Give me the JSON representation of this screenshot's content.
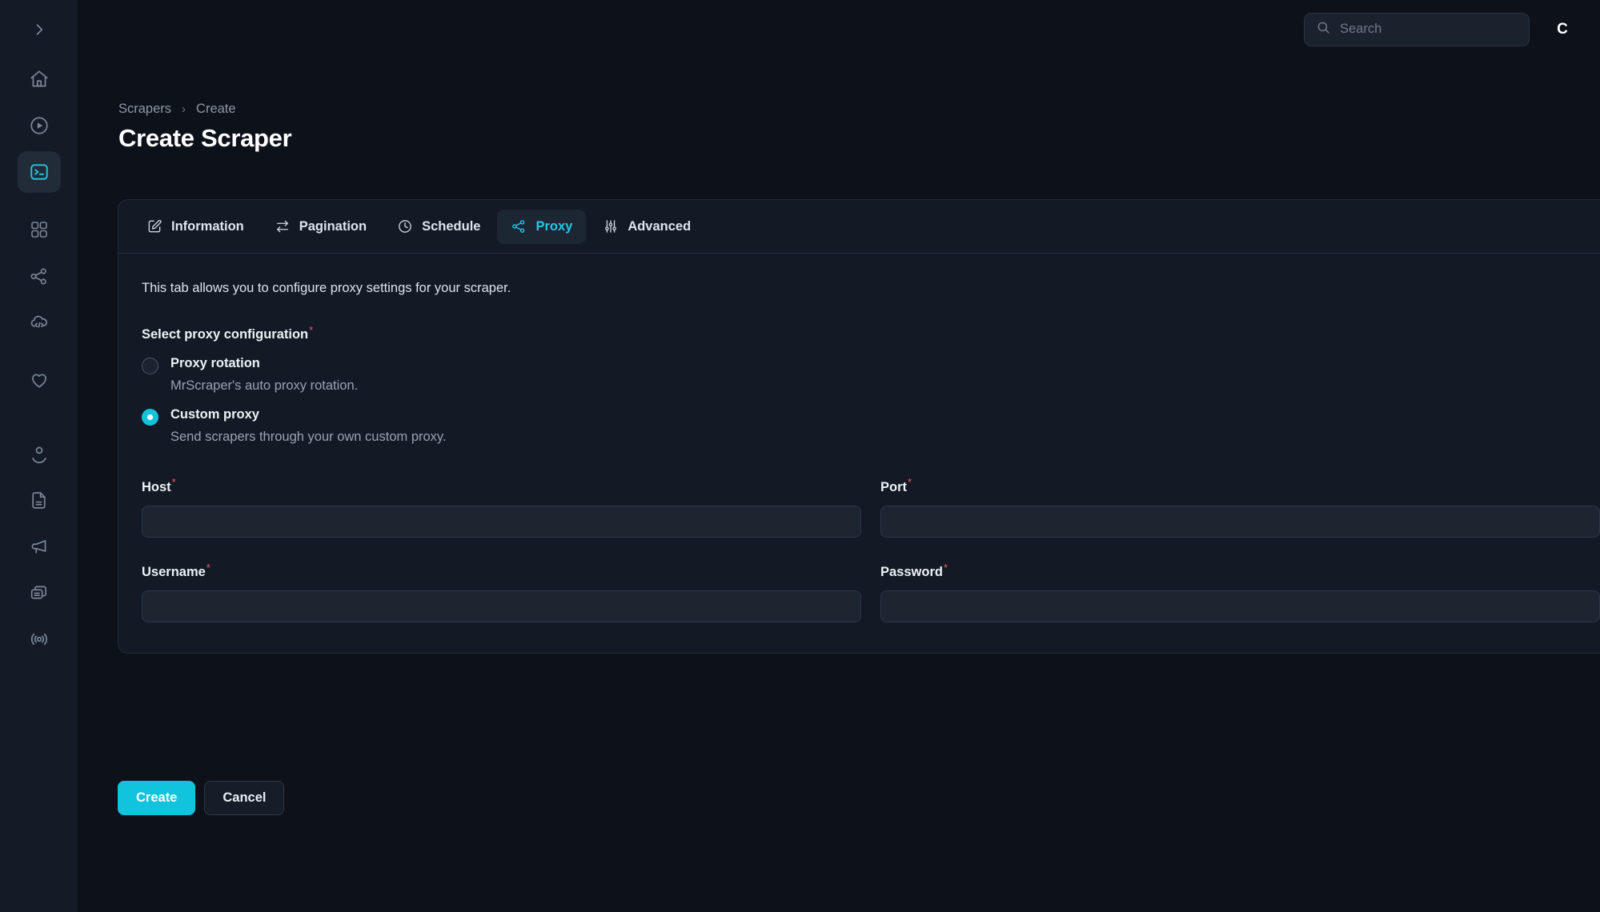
{
  "app": {
    "accent_color": "#11c3dc",
    "background_color": "#0c111a",
    "sidebar_color": "#141b26",
    "required_marker_color": "#ef5b5b"
  },
  "sidebar": {
    "collapse_icon": "chevron-right-icon",
    "items": [
      {
        "name": "home",
        "icon": "home-icon",
        "active": false
      },
      {
        "name": "runs",
        "icon": "play-circle-icon",
        "active": false
      },
      {
        "name": "scrapers",
        "icon": "terminal-icon",
        "active": true
      },
      {
        "name": "dashboard",
        "icon": "grid-icon",
        "active": false
      },
      {
        "name": "integrations",
        "icon": "share-network-icon",
        "active": false
      },
      {
        "name": "api",
        "icon": "cloud-code-icon",
        "active": false
      },
      {
        "name": "favorites",
        "icon": "heart-icon",
        "active": false
      },
      {
        "name": "account",
        "icon": "user-icon",
        "active": false
      },
      {
        "name": "documents",
        "icon": "document-icon",
        "active": false
      },
      {
        "name": "announcements",
        "icon": "megaphone-icon",
        "active": false
      },
      {
        "name": "copies",
        "icon": "copy-icon",
        "active": false
      },
      {
        "name": "broadcast",
        "icon": "signal-icon",
        "active": false
      }
    ]
  },
  "header": {
    "search": {
      "icon": "search-icon",
      "placeholder": "Search",
      "value": ""
    },
    "avatar_initial": "C"
  },
  "breadcrumb": {
    "items": [
      "Scrapers",
      "Create"
    ],
    "separator": "›"
  },
  "page": {
    "title": "Create Scraper"
  },
  "tabs": [
    {
      "label": "Information",
      "icon": "edit-square-icon",
      "active": false
    },
    {
      "label": "Pagination",
      "icon": "swap-arrows-icon",
      "active": false
    },
    {
      "label": "Schedule",
      "icon": "clock-icon",
      "active": false
    },
    {
      "label": "Proxy",
      "icon": "share-network-icon",
      "active": true
    },
    {
      "label": "Advanced",
      "icon": "sliders-icon",
      "active": false
    }
  ],
  "panel": {
    "description": "This tab allows you to configure proxy settings for your scraper.",
    "proxy_config_label": "Select proxy configuration",
    "proxy_config_required": "*",
    "options": [
      {
        "title": "Proxy rotation",
        "subtitle": "MrScraper's auto proxy rotation.",
        "selected": false
      },
      {
        "title": "Custom proxy",
        "subtitle": "Send scrapers through your own custom proxy.",
        "selected": true
      }
    ],
    "fields": [
      {
        "label": "Host",
        "required": "*",
        "value": "",
        "placeholder": ""
      },
      {
        "label": "Port",
        "required": "*",
        "value": "",
        "placeholder": ""
      },
      {
        "label": "Username",
        "required": "*",
        "value": "",
        "placeholder": ""
      },
      {
        "label": "Password",
        "required": "*",
        "value": "",
        "placeholder": ""
      }
    ]
  },
  "footer": {
    "create_label": "Create",
    "cancel_label": "Cancel"
  }
}
